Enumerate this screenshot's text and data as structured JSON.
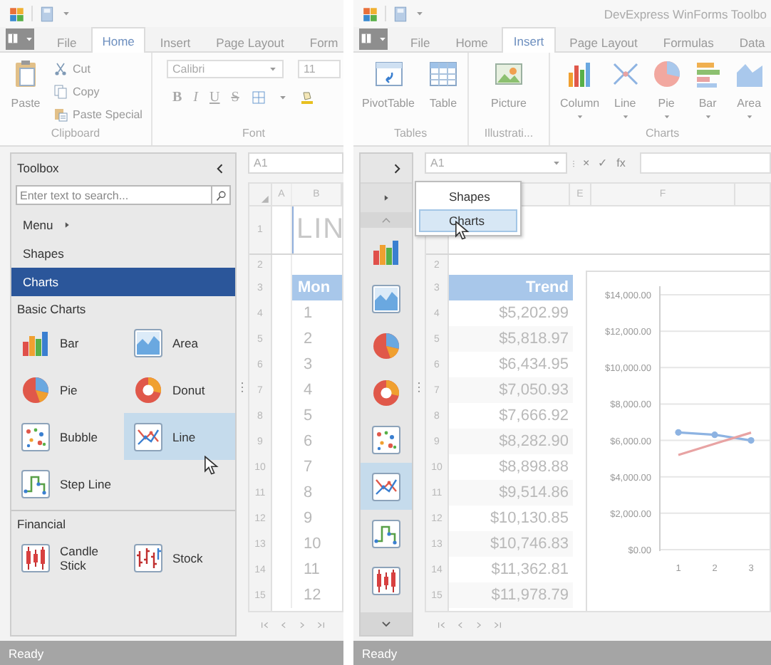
{
  "left_window": {
    "tabs": [
      {
        "label": "File",
        "selected": false
      },
      {
        "label": "Home",
        "selected": true
      },
      {
        "label": "Insert",
        "selected": false
      },
      {
        "label": "Page Layout",
        "selected": false
      },
      {
        "label": "Form",
        "selected": false
      }
    ],
    "clipboard_group": {
      "label": "Clipboard",
      "paste": "Paste",
      "items": [
        {
          "kind": "cut",
          "label": "Cut"
        },
        {
          "kind": "copy",
          "label": "Copy"
        },
        {
          "kind": "paste-special",
          "label": "Paste Special"
        }
      ]
    },
    "font_group": {
      "label": "Font",
      "font_name": "Calibri",
      "font_size": "11",
      "styles": [
        {
          "kind": "bold",
          "label": "B"
        },
        {
          "kind": "italic",
          "label": "I"
        },
        {
          "kind": "underline",
          "label": "U"
        },
        {
          "kind": "strike",
          "label": "S"
        }
      ]
    },
    "toolbox": {
      "title": "Toolbox",
      "search": {
        "placeholder": "Enter text to search..."
      },
      "nav": [
        {
          "label": "Menu",
          "kind": "submenu",
          "selected": false
        },
        {
          "label": "Shapes",
          "kind": "category",
          "selected": false
        },
        {
          "label": "Charts",
          "kind": "category",
          "selected": true
        }
      ],
      "groups": [
        {
          "label": "Basic Charts",
          "items": [
            {
              "kind": "bar",
              "label": "Bar",
              "selected": false
            },
            {
              "kind": "area",
              "label": "Area",
              "selected": false
            },
            {
              "kind": "pie",
              "label": "Pie",
              "selected": false
            },
            {
              "kind": "donut",
              "label": "Donut",
              "selected": false
            },
            {
              "kind": "bubble",
              "label": "Bubble",
              "selected": false
            },
            {
              "kind": "line",
              "label": "Line",
              "selected": true
            },
            {
              "kind": "step-line",
              "label": "Step Line",
              "selected": false
            }
          ]
        },
        {
          "label": "Financial",
          "items": [
            {
              "kind": "candle-stick",
              "label": "Candle Stick",
              "selected": false
            },
            {
              "kind": "stock",
              "label": "Stock",
              "selected": false
            }
          ]
        }
      ]
    },
    "name_box": "A1",
    "columns": [
      "A",
      "B"
    ],
    "rows": [
      {
        "number": "1",
        "kind": "title",
        "value": "LIN"
      },
      {
        "number": "2",
        "kind": "blank"
      },
      {
        "number": "3",
        "kind": "header",
        "value": "Mon"
      },
      {
        "number": "4",
        "kind": "value",
        "value": "1"
      },
      {
        "number": "5",
        "kind": "value",
        "value": "2"
      },
      {
        "number": "6",
        "kind": "value",
        "value": "3"
      },
      {
        "number": "7",
        "kind": "value",
        "value": "4"
      },
      {
        "number": "8",
        "kind": "value",
        "value": "5"
      },
      {
        "number": "9",
        "kind": "value",
        "value": "6"
      },
      {
        "number": "10",
        "kind": "value",
        "value": "7"
      },
      {
        "number": "11",
        "kind": "value",
        "value": "8"
      },
      {
        "number": "12",
        "kind": "value",
        "value": "9"
      },
      {
        "number": "13",
        "kind": "value",
        "value": "10"
      },
      {
        "number": "14",
        "kind": "value",
        "value": "11"
      },
      {
        "number": "15",
        "kind": "value",
        "value": "12"
      }
    ],
    "status": "Ready"
  },
  "right_window": {
    "title": "DevExpress WinForms Toolbo",
    "tabs": [
      {
        "label": "File",
        "selected": false
      },
      {
        "label": "Home",
        "selected": false
      },
      {
        "label": "Insert",
        "selected": true
      },
      {
        "label": "Page Layout",
        "selected": false
      },
      {
        "label": "Formulas",
        "selected": false
      },
      {
        "label": "Data",
        "selected": false
      }
    ],
    "ribbon_groups": [
      {
        "label": "Tables",
        "buttons": [
          {
            "kind": "pivot-table",
            "label": "PivotTable",
            "dropdown": false
          },
          {
            "kind": "table",
            "label": "Table",
            "dropdown": false
          }
        ]
      },
      {
        "label": "Illustrati...",
        "buttons": [
          {
            "kind": "picture",
            "label": "Picture",
            "dropdown": false
          }
        ]
      },
      {
        "label": "Charts",
        "buttons": [
          {
            "kind": "column",
            "label": "Column",
            "dropdown": true
          },
          {
            "kind": "line",
            "label": "Line",
            "dropdown": true
          },
          {
            "kind": "pie",
            "label": "Pie",
            "dropdown": true
          },
          {
            "kind": "bar",
            "label": "Bar",
            "dropdown": true
          },
          {
            "kind": "area",
            "label": "Area",
            "dropdown": true
          }
        ]
      }
    ],
    "toolbox": {
      "items": [
        {
          "kind": "bar",
          "selected": false
        },
        {
          "kind": "area",
          "selected": false
        },
        {
          "kind": "pie",
          "selected": false
        },
        {
          "kind": "donut",
          "selected": false
        },
        {
          "kind": "bubble",
          "selected": false
        },
        {
          "kind": "line",
          "selected": true
        },
        {
          "kind": "step-line",
          "selected": false
        },
        {
          "kind": "candle-stick",
          "selected": false
        }
      ],
      "menu": [
        {
          "label": "Shapes",
          "selected": false
        },
        {
          "label": "Charts",
          "selected": true
        }
      ]
    },
    "name_box": "A1",
    "formula_buttons": [
      "×",
      "✓",
      "fx"
    ],
    "columns": [
      "E",
      "F"
    ],
    "rows": [
      {
        "number": "2",
        "kind": "blank"
      },
      {
        "number": "3",
        "kind": "header",
        "value": "Trend"
      },
      {
        "number": "4",
        "kind": "value",
        "value": "$5,202.99"
      },
      {
        "number": "5",
        "kind": "value",
        "value": "$5,818.97"
      },
      {
        "number": "6",
        "kind": "value",
        "value": "$6,434.95"
      },
      {
        "number": "7",
        "kind": "value",
        "value": "$7,050.93"
      },
      {
        "number": "8",
        "kind": "value",
        "value": "$7,666.92"
      },
      {
        "number": "9",
        "kind": "value",
        "value": "$8,282.90"
      },
      {
        "number": "10",
        "kind": "value",
        "value": "$8,898.88"
      },
      {
        "number": "11",
        "kind": "value",
        "value": "$9,514.86"
      },
      {
        "number": "12",
        "kind": "value",
        "value": "$10,130.85"
      },
      {
        "number": "13",
        "kind": "value",
        "value": "$10,746.83"
      },
      {
        "number": "14",
        "kind": "value",
        "value": "$11,362.81"
      },
      {
        "number": "15",
        "kind": "value",
        "value": "$11,978.79"
      }
    ],
    "chart": {
      "chart_data": {
        "type": "line",
        "categories": [
          "1",
          "2",
          "3"
        ],
        "ylim": [
          0,
          14000
        ],
        "yticks": [
          {
            "value": 0,
            "label": "$0.00"
          },
          {
            "value": 2000,
            "label": "$2,000.00"
          },
          {
            "value": 4000,
            "label": "$4,000.00"
          },
          {
            "value": 6000,
            "label": "$6,000.00"
          },
          {
            "value": 8000,
            "label": "$8,000.00"
          },
          {
            "value": 10000,
            "label": "$10,000.00"
          },
          {
            "value": 12000,
            "label": "$12,000.00"
          },
          {
            "value": 14000,
            "label": "$14,000.00"
          }
        ],
        "grid": true,
        "series": [
          {
            "color": "#8db3e2",
            "marker": true,
            "values": [
              6440,
              6310,
              6000
            ]
          },
          {
            "color": "#e8a3a3",
            "marker": false,
            "values": [
              5200,
              5820,
              6430
            ]
          }
        ]
      }
    },
    "status": "Ready"
  }
}
